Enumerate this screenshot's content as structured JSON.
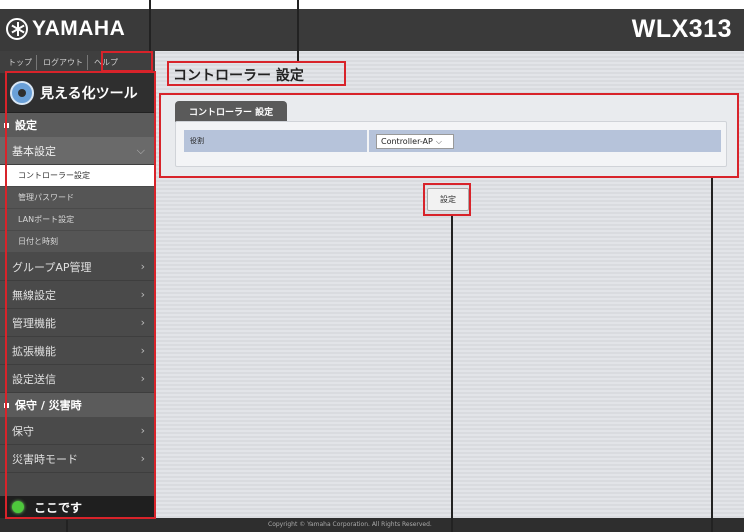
{
  "header": {
    "brand": "YAMAHA",
    "model": "WLX313"
  },
  "topnav": {
    "top": "トップ",
    "logout": "ログアウト",
    "help": "ヘルプ"
  },
  "sidebar": {
    "tool": "見える化ツール",
    "section_settings": "設定",
    "basic_settings": "基本設定",
    "sub_items": [
      "コントローラー設定",
      "管理パスワード",
      "LANポート設定",
      "日付と時刻"
    ],
    "menu_items": [
      "グループAP管理",
      "無線設定",
      "管理機能",
      "拡張機能",
      "設定送信"
    ],
    "section_maintenance": "保守 / 災害時",
    "maint_items": [
      "保守",
      "災害時モード"
    ],
    "here": "ここです"
  },
  "main": {
    "page_title": "コントローラー 設定",
    "panel_tab": "コントローラー 設定",
    "row_label": "役割",
    "role_value": "Controller-AP",
    "submit": "設定"
  },
  "footer": {
    "copyright": "Copyright © Yamaha Corporation. All Rights Reserved."
  },
  "colors": {
    "header": "#3a3a3a",
    "sidebar": "#4a4a4a",
    "row_bg": "#b6c3da",
    "annotation": "#d8232a",
    "status_dot": "#4ec83c"
  }
}
